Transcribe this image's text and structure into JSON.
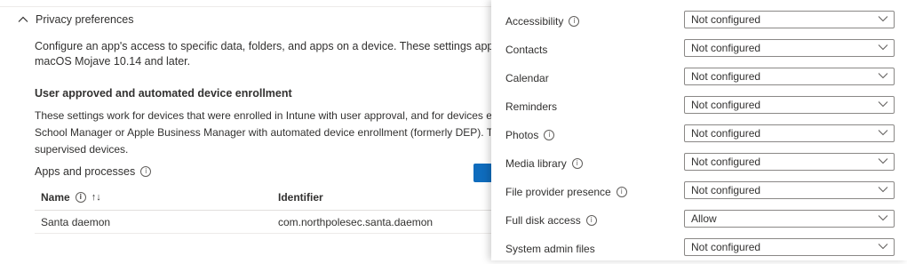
{
  "section": {
    "title": "Privacy preferences",
    "description_line1": "Configure an app's access to specific data, folders, and apps on a device. These settings apply to devices",
    "description_line2": "macOS Mojave 10.14 and later.",
    "subheading": "User approved and automated device enrollment",
    "body_line1": "These settings work for devices that were enrolled in Intune with user approval, and for devices enrolled using",
    "body_line2": "School Manager or Apple Business Manager with automated device enrollment (formerly DEP). This includes",
    "body_line3": "supervised devices.",
    "apps_label": "Apps and processes"
  },
  "table": {
    "columns": [
      "Name",
      "Identifier"
    ],
    "rows": [
      {
        "name": "Santa daemon",
        "identifier": "com.northpolesec.santa.daemon"
      }
    ]
  },
  "panel": {
    "settings": [
      {
        "label": "Accessibility",
        "info": true,
        "value": "Not configured"
      },
      {
        "label": "Contacts",
        "info": false,
        "value": "Not configured"
      },
      {
        "label": "Calendar",
        "info": false,
        "value": "Not configured"
      },
      {
        "label": "Reminders",
        "info": false,
        "value": "Not configured"
      },
      {
        "label": "Photos",
        "info": true,
        "value": "Not configured"
      },
      {
        "label": "Media library",
        "info": true,
        "value": "Not configured"
      },
      {
        "label": "File provider presence",
        "info": true,
        "value": "Not configured"
      },
      {
        "label": "Full disk access",
        "info": true,
        "value": "Allow"
      },
      {
        "label": "System admin files",
        "info": false,
        "value": "Not configured"
      }
    ]
  },
  "icons": {
    "info": "info-icon",
    "section_toggle": "chevron-up-icon",
    "sort": "sort-icon",
    "dropdown": "chevron-down-icon"
  },
  "colors": {
    "accent": "#0f6cbd",
    "text": "#323130"
  }
}
